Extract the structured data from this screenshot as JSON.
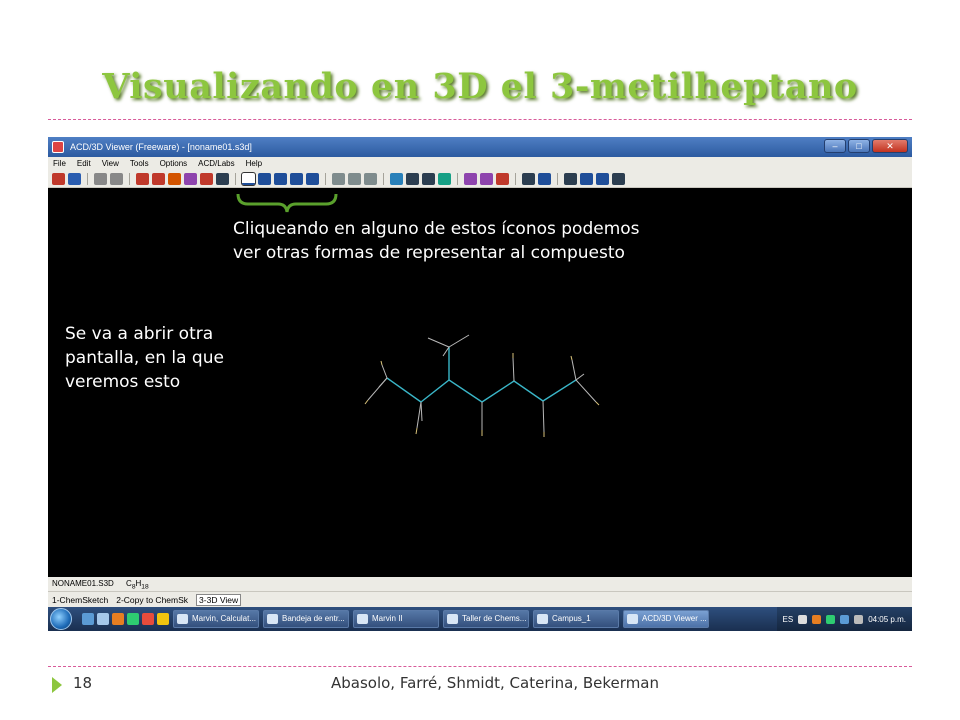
{
  "slide": {
    "title": "Visualizando en 3D el 3-metilheptano",
    "page_number": "18",
    "authors": "Abasolo, Farré, Shmidt, Caterina, Bekerman"
  },
  "window": {
    "title": "ACD/3D Viewer (Freeware) - [noname01.s3d]",
    "controls": [
      "–",
      "□",
      "✕"
    ]
  },
  "menu": [
    "File",
    "Edit",
    "View",
    "Tools",
    "Options",
    "ACD/Labs",
    "Help"
  ],
  "toolbar_icon_colors": [
    "#c0392b",
    "#2a5db0",
    "#888888",
    "#888888",
    "#c0392b",
    "#c0392b",
    "#d35400",
    "#8e44ad",
    "#c0392b",
    "#2c3e50",
    "#1f4e99",
    "#1f4e99",
    "#1f4e99",
    "#1f4e99",
    "#1f4e99",
    "#7f8c8d",
    "#7f8c8d",
    "#7f8c8d",
    "#2980b9",
    "#2c3e50",
    "#2c3e50",
    "#16a085",
    "#8e44ad",
    "#8e44ad",
    "#c0392b",
    "#2c3e50",
    "#1f4e99",
    "#2c3e50",
    "#1f4e99",
    "#1f4e99",
    "#2c3e50"
  ],
  "annotations": {
    "icons_note": [
      "Cliqueando en alguno de estos íconos podemos",
      "ver otras formas de representar al compuesto"
    ],
    "window_note": [
      "Se va a abrir otra",
      "pantalla, en la que",
      "veremos esto"
    ]
  },
  "status": {
    "file": "NONAME01.S3D",
    "formula_main": "C",
    "formula_sub1": "8",
    "formula_h": "H",
    "formula_sub2": "18"
  },
  "tabs": [
    "1-ChemSketch",
    "2-Copy to ChemSk",
    "3-3D View"
  ],
  "taskbar": {
    "tasks": [
      "Marvin, Calculat...",
      "Bandeja de entr...",
      "Marvin II",
      "Taller de Chems...",
      "Campus_1",
      "ACD/3D Viewer ..."
    ],
    "lang": "ES",
    "clock": "04:05 p.m."
  },
  "colors": {
    "title_green": "#8dc63f",
    "divider_pink": "#d85a9a",
    "bond_cyan": "#3ab6c8",
    "bracket_green": "#5aa02c"
  }
}
